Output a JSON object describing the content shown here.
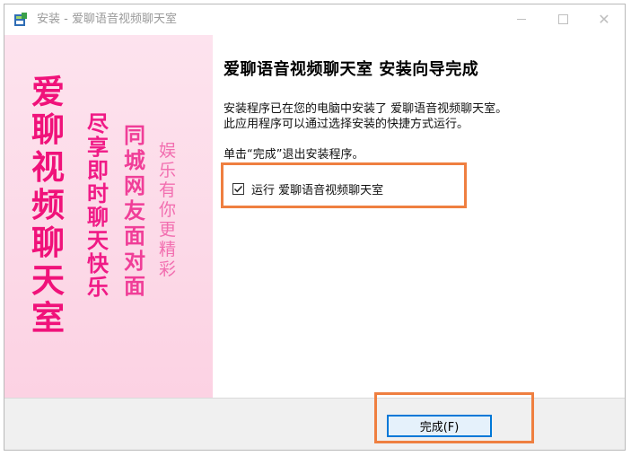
{
  "window": {
    "title": "安装 - 爱聊语音视频聊天室"
  },
  "banner": {
    "col1": [
      "爱",
      "聊",
      "视",
      "频",
      "聊",
      "天",
      "室"
    ],
    "col2": [
      "尽",
      "享",
      "即",
      "时",
      "聊",
      "天",
      "快",
      "乐"
    ],
    "col3": [
      "同",
      "城",
      "网",
      "友",
      "面",
      "对",
      "面"
    ],
    "col4": [
      "娱",
      "乐",
      "有",
      "你",
      "更",
      "精",
      "彩"
    ]
  },
  "main": {
    "heading": "爱聊语音视频聊天室  安装向导完成",
    "desc_line1": "安装程序已在您的电脑中安装了 爱聊语音视频聊天室。",
    "desc_line2": "此应用程序可以通过选择安装的快捷方式运行。",
    "instruction": "单击“完成”退出安装程序。",
    "run_checkbox_label": "运行  爱聊语音视频聊天室",
    "run_checked": true
  },
  "footer": {
    "finish_label": "完成(F)"
  },
  "colors": {
    "highlight": "#ef7f40",
    "banner_pink": "#f0127a",
    "button_border": "#0078d7"
  }
}
